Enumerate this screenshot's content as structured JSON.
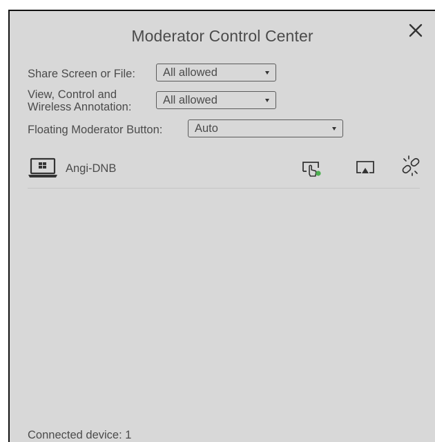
{
  "dialog": {
    "title": "Moderator Control Center",
    "close_icon": "close-icon"
  },
  "settings": {
    "share": {
      "label": "Share Screen or File:",
      "value": "All allowed"
    },
    "view_control": {
      "label_line1": "View, Control and",
      "label_line2": "Wireless Annotation:",
      "value": "All allowed"
    },
    "floating_button": {
      "label": "Floating Moderator Button:",
      "value": "Auto"
    }
  },
  "devices": [
    {
      "name": "Angi-DNB",
      "type_icon": "windows-laptop-icon",
      "actions": [
        "remote-control-icon",
        "share-screen-icon",
        "disconnect-link-icon"
      ],
      "status_color": "#4caf50"
    }
  ],
  "footer": {
    "connected_text": "Connected device: 1"
  },
  "colors": {
    "panel_background": "#d8d8d8",
    "text": "#4b4b4b",
    "status_green": "#4caf50"
  }
}
